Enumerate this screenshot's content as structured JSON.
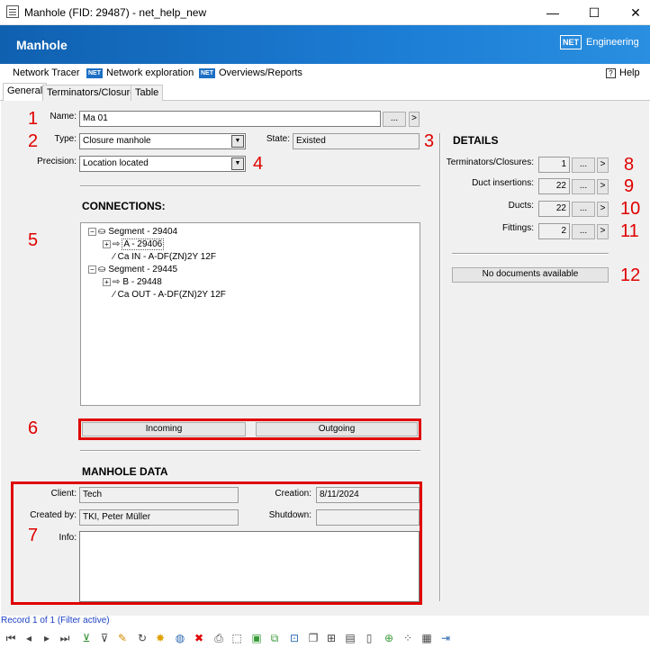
{
  "window": {
    "title": "Manhole (FID: 29487) - net_help_new",
    "minimize": "—",
    "maximize": "☐",
    "close": "✕"
  },
  "header": {
    "title": "Manhole",
    "logo_badge": "NET",
    "logo_text": "Engineering"
  },
  "menu": {
    "network_tracer": "Network Tracer",
    "network_exploration": "Network exploration",
    "overviews_reports": "Overviews/Reports",
    "help": "Help",
    "help_glyph": "?",
    "net_badge": "NET"
  },
  "tabs": [
    "General",
    "Terminators/Closures",
    "Table"
  ],
  "form": {
    "name_label": "Name:",
    "name_value": "Ma 01",
    "type_label": "Type:",
    "type_value": "Closure manhole",
    "state_label": "State:",
    "state_value": "Existed",
    "precision_label": "Precision:",
    "precision_value": "Location located",
    "ellipsis": "...",
    "arrow": ">"
  },
  "connections": {
    "title": "CONNECTIONS:",
    "tree": [
      {
        "label": "Segment - 29404"
      },
      {
        "label": "A - 29406"
      },
      {
        "label": "Ca IN - A-DF(ZN)2Y 12F"
      },
      {
        "label": "Segment - 29445"
      },
      {
        "label": "B - 29448"
      },
      {
        "label": "Ca OUT - A-DF(ZN)2Y 12F"
      }
    ],
    "incoming": "Incoming",
    "outgoing": "Outgoing"
  },
  "details": {
    "title": "DETAILS",
    "rows": [
      {
        "label": "Terminators/Closures:",
        "value": "1"
      },
      {
        "label": "Duct insertions:",
        "value": "22"
      },
      {
        "label": "Ducts:",
        "value": "22"
      },
      {
        "label": "Fittings:",
        "value": "2"
      }
    ],
    "documents": "No documents available"
  },
  "manhole_data": {
    "title": "MANHOLE DATA",
    "client_label": "Client:",
    "client_value": "Tech",
    "creation_label": "Creation:",
    "creation_value": "8/11/2024",
    "created_by_label": "Created by:",
    "created_by_value": "TKI, Peter Müller",
    "shutdown_label": "Shutdown:",
    "shutdown_value": "",
    "info_label": "Info:",
    "info_value": ""
  },
  "annotations": [
    "1",
    "2",
    "3",
    "4",
    "5",
    "6",
    "7",
    "8",
    "9",
    "10",
    "11",
    "12"
  ],
  "status": {
    "record": "Record 1 of 1 (Filter active)"
  },
  "toolbar": {
    "icons": [
      "first-record-icon",
      "prev-record-icon",
      "next-record-icon",
      "last-record-icon",
      "add-filter-icon",
      "filter-icon",
      "edit-icon",
      "refresh-icon",
      "highlight-icon",
      "globe-icon",
      "delete-icon",
      "print-icon",
      "select-icon",
      "layer-icon",
      "layers-icon",
      "zoom-icon",
      "copy-icon",
      "new-icon",
      "report-icon",
      "document-icon",
      "add-document-icon",
      "network-icon",
      "table-icon",
      "export-icon"
    ]
  }
}
